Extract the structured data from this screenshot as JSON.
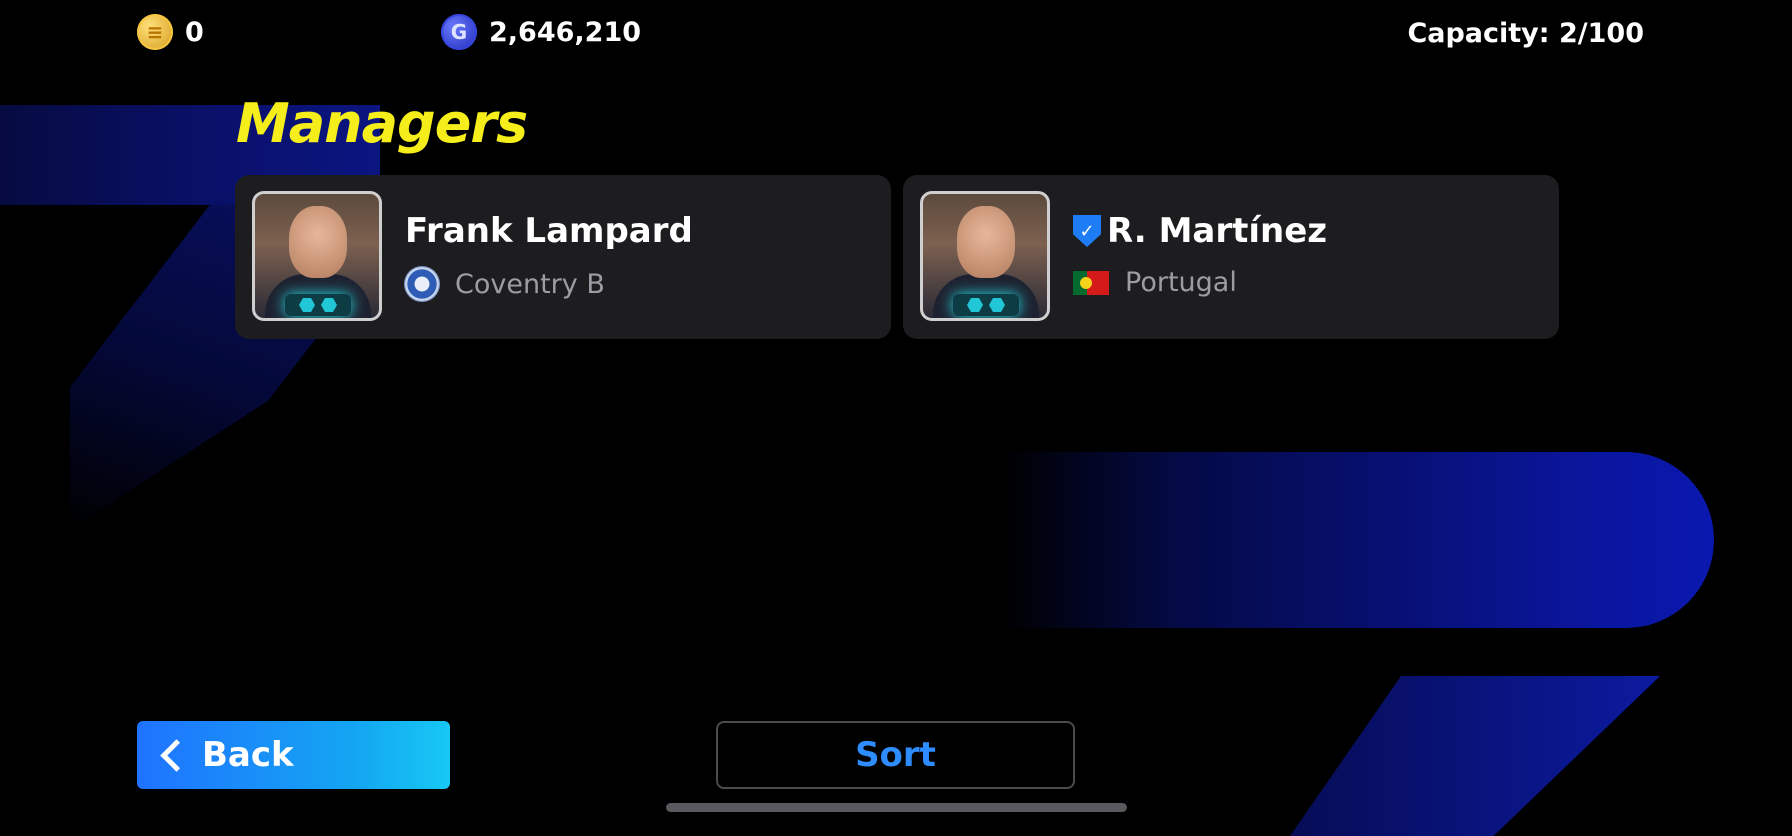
{
  "currencies": {
    "coins": {
      "icon": "coin-icon",
      "value": "0"
    },
    "gp": {
      "icon": "gp-icon",
      "value": "2,646,210"
    }
  },
  "capacity": "Capacity: 2/100",
  "page_title": "Managers",
  "managers": [
    {
      "name": "Frank Lampard",
      "team": "Coventry B",
      "team_icon": "club-crest-icon",
      "verified": false
    },
    {
      "name": "R. Martínez",
      "team": "Portugal",
      "team_icon": "portugal-flag-icon",
      "verified": true
    }
  ],
  "buttons": {
    "back": "Back",
    "sort": "Sort"
  },
  "colors": {
    "title": "#f6ee1a",
    "accent_blue": "#2f8cff"
  }
}
